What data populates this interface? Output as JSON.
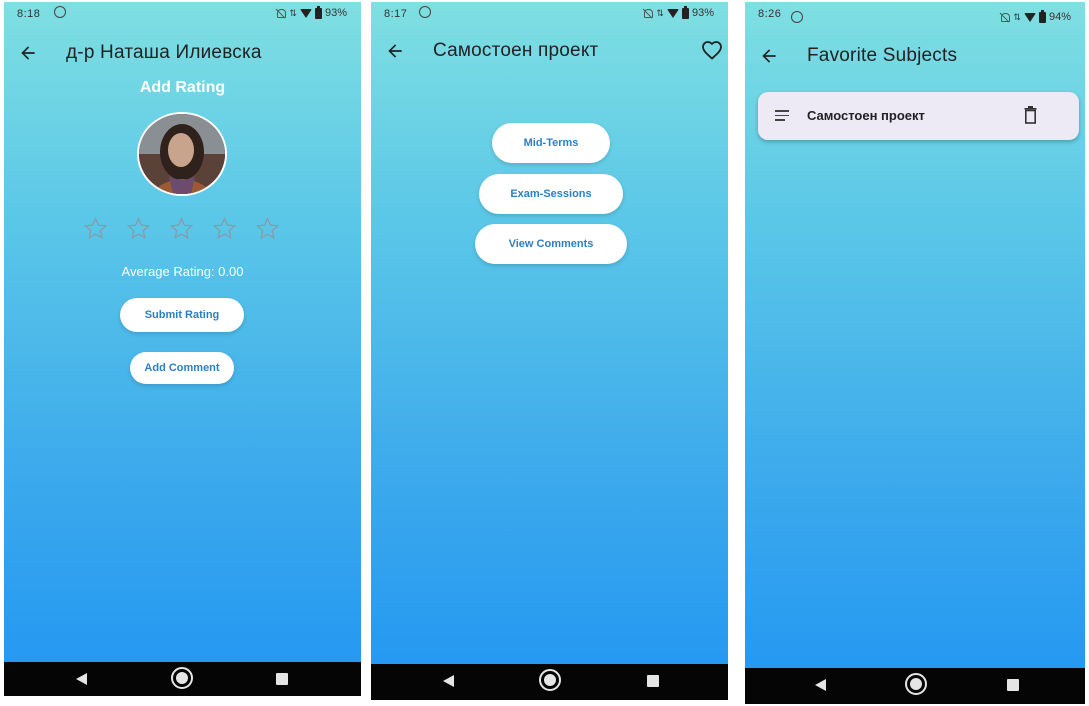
{
  "screen1": {
    "status": {
      "time": "8:18",
      "battery": "93%"
    },
    "title": "д-р Наташа Илиевска",
    "heading": "Add Rating",
    "stars_selected": 0,
    "average_rating": "Average Rating: 0.00",
    "submit_label": "Submit Rating",
    "comment_label": "Add Comment"
  },
  "screen2": {
    "status": {
      "time": "8:17",
      "battery": "93%"
    },
    "title": "Самостоен проект",
    "buttons": [
      "Mid-Terms",
      "Exam-Sessions",
      "View Comments"
    ]
  },
  "screen3": {
    "status": {
      "time": "8:26",
      "battery": "94%"
    },
    "title": "Favorite Subjects",
    "items": [
      {
        "label": "Самостоен проект"
      }
    ]
  },
  "icons": [
    "back-arrow-icon",
    "heart-icon",
    "star-outline-icon",
    "list-icon",
    "trash-icon",
    "nav-back-icon",
    "nav-home-icon",
    "nav-recent-icon"
  ],
  "colors": {
    "gradient_top": "#7fdfe1",
    "gradient_bottom": "#2196f3",
    "button_text": "#2d7fc1",
    "card": "#ede9f5"
  }
}
